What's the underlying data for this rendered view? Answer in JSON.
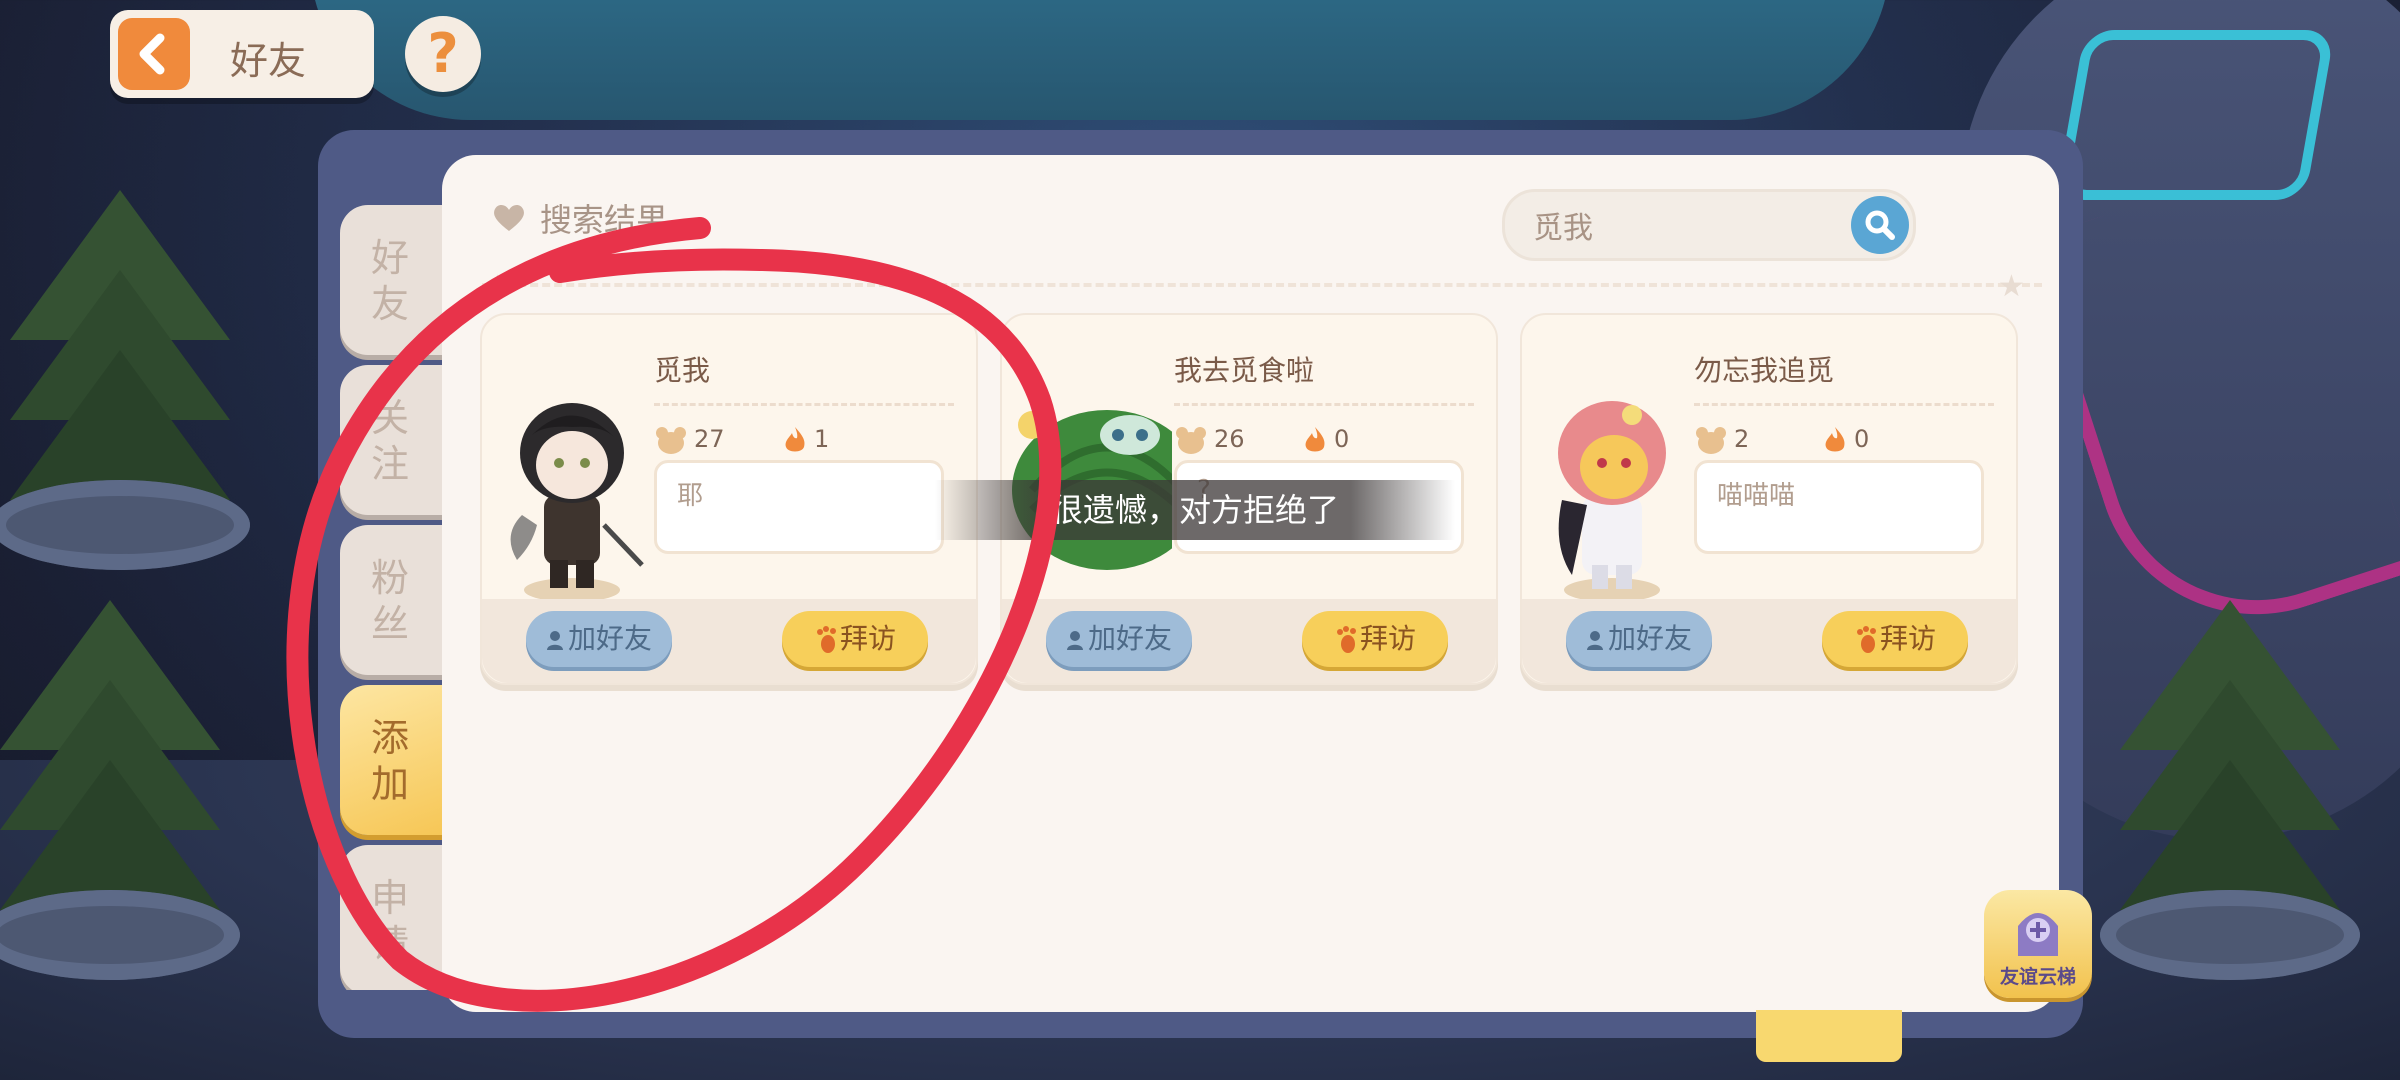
{
  "header": {
    "title": "好友",
    "help_label": "?"
  },
  "tabs": [
    {
      "label": "好友",
      "active": false
    },
    {
      "label": "关注",
      "active": false
    },
    {
      "label": "粉丝",
      "active": false
    },
    {
      "label": "添加",
      "active": true
    },
    {
      "label": "申请",
      "active": false
    }
  ],
  "search": {
    "title": "搜索结果",
    "query": "觅我"
  },
  "results": [
    {
      "name": "觅我",
      "stat1": "27",
      "stat2": "1",
      "message": "耶",
      "add_label": "加好友",
      "visit_label": "拜访"
    },
    {
      "name": "我去觅食啦",
      "stat1": "26",
      "stat2": "0",
      "message": "?",
      "add_label": "加好友",
      "visit_label": "拜访"
    },
    {
      "name": "勿忘我追觅",
      "stat1": "2",
      "stat2": "0",
      "message": "喵喵喵",
      "add_label": "加好友",
      "visit_label": "拜访"
    }
  ],
  "toast": "很遗憾，对方拒绝了",
  "friendship_ladder": "友谊云梯",
  "colors": {
    "accent_orange": "#f08a3c",
    "search_blue": "#5aa6d4",
    "panel_navy": "#4f5a86",
    "annotation_red": "#e8334a"
  },
  "icons": [
    "back-arrow-icon",
    "help-icon",
    "heart-icon",
    "search-icon",
    "bear-icon",
    "flame-icon",
    "person-icon",
    "footprint-icon",
    "ladder-icon"
  ]
}
